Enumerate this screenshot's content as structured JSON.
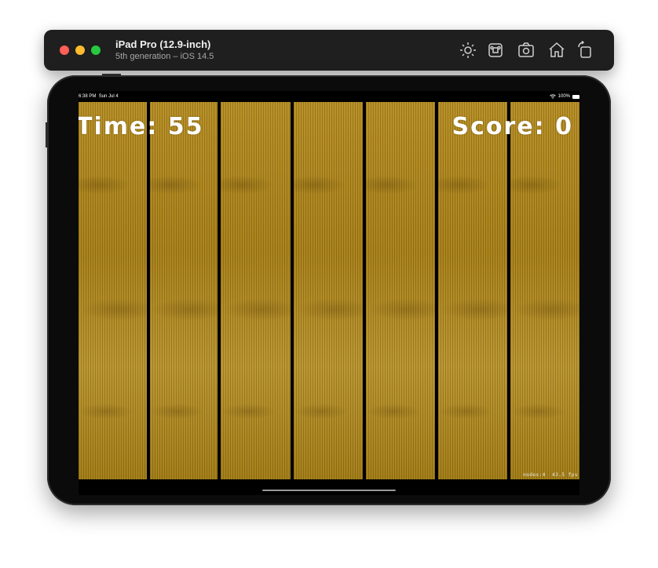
{
  "simulator": {
    "title": "iPad Pro (12.9-inch)",
    "subtitle": "5th generation – iOS 14.5",
    "toolbar_icons": [
      "brightness-icon",
      "command-icon",
      "screenshot-camera-icon",
      "home-icon",
      "rotate-icon"
    ]
  },
  "status_bar": {
    "time": "6:38 PM",
    "date": "Sun Jul 4",
    "battery": "100%"
  },
  "game": {
    "time_label": "Time: 55",
    "score_label": "Score: 0",
    "debug_nodes": "nodes:4",
    "debug_fps": "43.5 fps"
  },
  "colors": {
    "wood": "#b08a1c",
    "toolbar": "#1f1f1f"
  }
}
